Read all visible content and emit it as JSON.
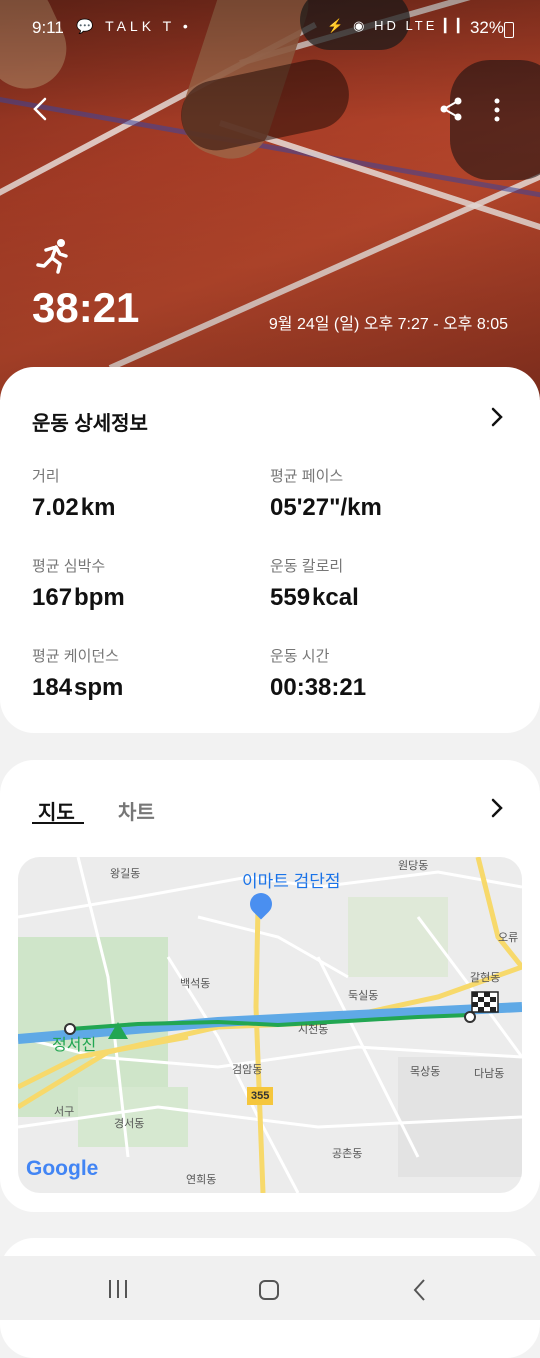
{
  "status_bar": {
    "time": "9:11",
    "battery": "32%",
    "left_icons": "💬 TALK T •",
    "right_icons": "⚡ ◉ HD LTE ▎▎"
  },
  "header": {
    "duration": "38:21",
    "date_range": "9월 24일 (일) 오후 7:27 - 오후 8:05",
    "icons": [
      "back-icon",
      "share-icon",
      "more-icon",
      "running-icon"
    ]
  },
  "details": {
    "title": "운동 상세정보",
    "stats": [
      {
        "label": "거리",
        "value": "7.02",
        "unit": "km"
      },
      {
        "label": "평균 페이스",
        "value": "05'27\"/km",
        "unit": ""
      },
      {
        "label": "평균 심박수",
        "value": "167",
        "unit": "bpm"
      },
      {
        "label": "운동 칼로리",
        "value": "559",
        "unit": "kcal"
      },
      {
        "label": "평균 케이던스",
        "value": "184",
        "unit": "spm"
      },
      {
        "label": "운동 시간",
        "value": "00:38:21",
        "unit": ""
      }
    ]
  },
  "map_card": {
    "tabs": [
      {
        "label": "지도",
        "selected": true
      },
      {
        "label": "차트",
        "selected": false
      }
    ],
    "map": {
      "poi": "이마트 검단점",
      "labels": [
        "원당동",
        "왕길동",
        "오류",
        "갈현동",
        "백석동",
        "둑실동",
        "정서진",
        "시천동",
        "검암동",
        "목상동",
        "다남동",
        "서구",
        "경서동",
        "공촌동",
        "연희동",
        "355"
      ],
      "attribution": "Google"
    }
  },
  "colors": {
    "accent_green": "#22a652",
    "route_blue": "#5fa9e6",
    "road_yellow": "#f7d96b"
  }
}
